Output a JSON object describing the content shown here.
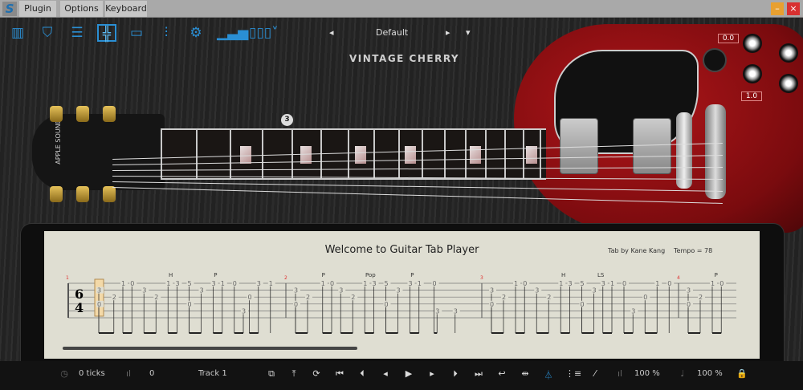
{
  "menubar": {
    "items": [
      "Plugin",
      "Options",
      "Keyboard"
    ],
    "minimize": "–",
    "close": "×"
  },
  "toolbar": {
    "icons": [
      "piano-icon",
      "guitar-pick-icon",
      "strum-sliders-icon",
      "fx-grid-icon",
      "window-icon",
      "mixer-icon",
      "gear-icon",
      "equalizer-icon",
      "columns-icon"
    ],
    "preset": {
      "prev": "◂",
      "name": "Default",
      "next": "▸",
      "menu": "▾"
    }
  },
  "brand": "VINTAGE CHERRY",
  "fret_marker": "3",
  "controls": {
    "readout_top": "0.0",
    "readout_bottom": "1.0"
  },
  "tab": {
    "title": "Welcome to Guitar Tab Player",
    "author": "Tab by Kane Kang",
    "tempo": "Tempo = 78",
    "time_sig": [
      "6",
      "4"
    ],
    "measures": [
      {
        "number": "1",
        "notes": [
          [
            0,
            2,
            "3"
          ],
          [
            0,
            4,
            "0"
          ],
          [
            0.5,
            3,
            "2"
          ],
          [
            0.8,
            1,
            "1"
          ],
          [
            1.1,
            1,
            "0"
          ],
          [
            1.5,
            2,
            "3"
          ],
          [
            1.9,
            3,
            "2"
          ],
          [
            2.3,
            1,
            "1"
          ],
          [
            2.6,
            1,
            "3"
          ],
          [
            3,
            1,
            "5"
          ],
          [
            3,
            4,
            "0"
          ],
          [
            3.4,
            2,
            "3"
          ],
          [
            3.8,
            1,
            "3"
          ],
          [
            4.1,
            1,
            "1"
          ],
          [
            4.5,
            1,
            "0"
          ],
          [
            5,
            3,
            "0"
          ],
          [
            4.8,
            5,
            "3"
          ],
          [
            5.3,
            1,
            "3"
          ],
          [
            5.7,
            1,
            "1"
          ]
        ],
        "marks": [
          [
            2.4,
            "H"
          ],
          [
            3.9,
            "P"
          ]
        ]
      },
      {
        "number": "2",
        "notes": [
          [
            0,
            2,
            "3"
          ],
          [
            0,
            4,
            "0"
          ],
          [
            0.4,
            3,
            "2"
          ],
          [
            0.9,
            1,
            "1"
          ],
          [
            1.2,
            1,
            "0"
          ],
          [
            1.5,
            2,
            "3"
          ],
          [
            1.9,
            3,
            "2"
          ],
          [
            2.3,
            1,
            "1"
          ],
          [
            2.6,
            1,
            "3"
          ],
          [
            3,
            1,
            "5"
          ],
          [
            3,
            4,
            "0"
          ],
          [
            3.4,
            2,
            "3"
          ],
          [
            3.8,
            1,
            "3"
          ],
          [
            4.1,
            1,
            "1"
          ],
          [
            4.6,
            1,
            "0"
          ],
          [
            4.7,
            5,
            "3"
          ],
          [
            5.3,
            5,
            "3"
          ]
        ],
        "marks": [
          [
            0.95,
            "P"
          ],
          [
            2.4,
            "Pop"
          ],
          [
            3.9,
            "P"
          ]
        ]
      },
      {
        "number": "3",
        "notes": [
          [
            0,
            2,
            "3"
          ],
          [
            0,
            4,
            "0"
          ],
          [
            0.4,
            3,
            "2"
          ],
          [
            0.8,
            1,
            "1"
          ],
          [
            1.1,
            1,
            "0"
          ],
          [
            1.5,
            2,
            "3"
          ],
          [
            1.9,
            3,
            "2"
          ],
          [
            2.3,
            1,
            "1"
          ],
          [
            2.6,
            1,
            "3"
          ],
          [
            3,
            1,
            "5"
          ],
          [
            3,
            4,
            "0"
          ],
          [
            3.4,
            2,
            "3"
          ],
          [
            3.7,
            1,
            "3"
          ],
          [
            4.0,
            1,
            "1"
          ],
          [
            4.4,
            1,
            "0"
          ],
          [
            4.7,
            5,
            "3"
          ],
          [
            5.1,
            3,
            "0"
          ],
          [
            5.5,
            1,
            "1"
          ],
          [
            5.9,
            1,
            "0"
          ]
        ],
        "marks": [
          [
            2.4,
            "H"
          ],
          [
            3.6,
            "LS"
          ]
        ]
      },
      {
        "number": "4",
        "notes": [
          [
            0,
            2,
            "3"
          ],
          [
            0,
            4,
            "0"
          ],
          [
            0.4,
            3,
            "2"
          ],
          [
            0.8,
            1,
            "1"
          ],
          [
            1.1,
            1,
            "0"
          ]
        ],
        "marks": [
          [
            0.95,
            "P"
          ]
        ]
      }
    ]
  },
  "transport": {
    "ticks": "0 ticks",
    "velocity": "0",
    "track": "Track 1",
    "volume": "100 %",
    "speed": "100 %"
  },
  "colors": {
    "accent": "#2a8fd4",
    "measure_number": "#e03030",
    "body_red": "#a01418"
  }
}
